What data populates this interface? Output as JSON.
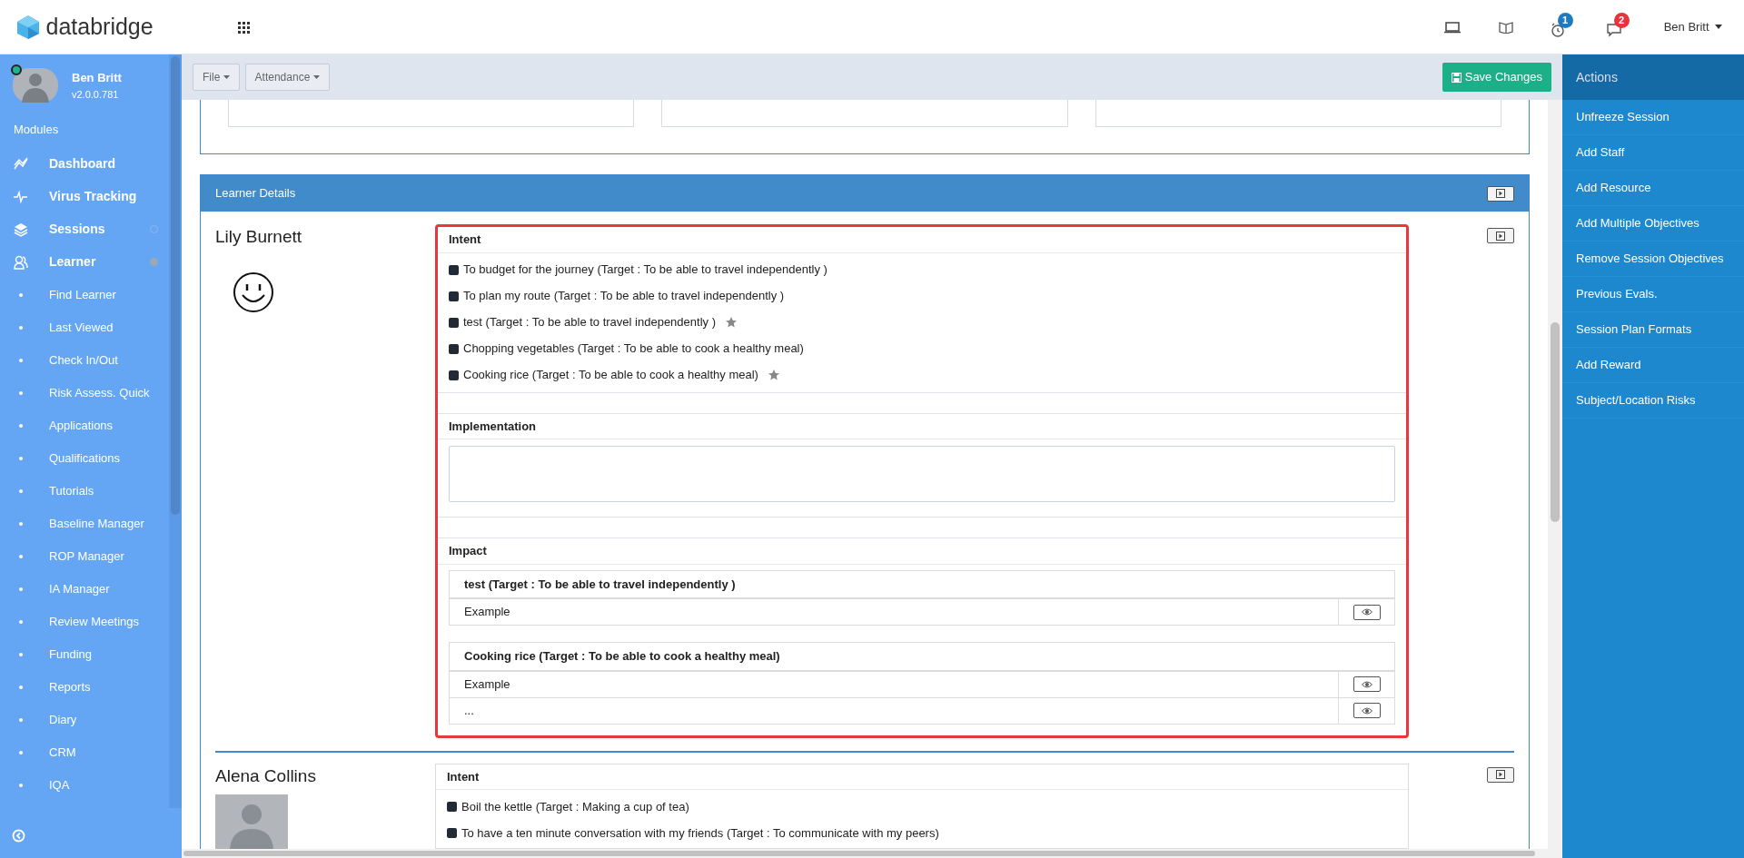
{
  "header": {
    "brand": "databridge",
    "notifications": [
      {
        "kind": "alarm",
        "badge": "1",
        "color": "#1f7bc1"
      },
      {
        "kind": "chat",
        "badge": "2",
        "color": "#e8323c"
      }
    ],
    "user": "Ben Britt"
  },
  "sidebar": {
    "user": {
      "name": "Ben Britt",
      "version": "v2.0.0.781",
      "online": true
    },
    "section": "Modules",
    "items": [
      {
        "label": "Dashboard",
        "kind": "link"
      },
      {
        "label": "Virus Tracking",
        "kind": "link"
      },
      {
        "label": "Sessions",
        "kind": "group",
        "expanded": false
      },
      {
        "label": "Learner",
        "kind": "group",
        "expanded": true,
        "children": [
          {
            "label": "Find Learner"
          },
          {
            "label": "Last Viewed"
          },
          {
            "label": "Check In/Out"
          },
          {
            "label": "Risk Assess. Quick"
          },
          {
            "label": "Applications"
          },
          {
            "label": "Qualifications"
          },
          {
            "label": "Tutorials"
          },
          {
            "label": "Baseline Manager"
          },
          {
            "label": "ROP Manager"
          },
          {
            "label": "IA Manager"
          },
          {
            "label": "Review Meetings"
          },
          {
            "label": "Funding"
          },
          {
            "label": "Reports"
          },
          {
            "label": "Diary"
          },
          {
            "label": "CRM"
          },
          {
            "label": "IQA"
          }
        ]
      }
    ]
  },
  "toolbar": {
    "menus": [
      "File",
      "Attendance"
    ],
    "save": "Save Changes"
  },
  "actions": {
    "title": "Actions",
    "items": [
      "Unfreeze Session",
      "Add Staff",
      "Add Resource",
      "Add Multiple Objectives",
      "Remove Session Objectives",
      "Previous Evals.",
      "Session Plan Formats",
      "Add Reward",
      "Subject/Location Risks"
    ]
  },
  "learner_details": {
    "title": "Learner Details",
    "learners": [
      {
        "name": "Lily Burnett",
        "highlighted": true,
        "intent_heading": "Intent",
        "intent": [
          {
            "text": "To budget for the journey (Target : To be able to travel independently )",
            "starred": false
          },
          {
            "text": "To plan my route (Target : To be able to travel independently )",
            "starred": false
          },
          {
            "text": "test (Target : To be able to travel independently )",
            "starred": true
          },
          {
            "text": "Chopping vegetables (Target : To be able to cook a healthy meal)",
            "starred": false
          },
          {
            "text": "Cooking rice (Target : To be able to cook a healthy meal)",
            "starred": true
          }
        ],
        "implementation_heading": "Implementation",
        "impact_heading": "Impact",
        "impact": [
          {
            "heading": "test (Target : To be able to travel independently )",
            "rows": [
              "Example"
            ]
          },
          {
            "heading": "Cooking rice (Target : To be able to cook a healthy meal)",
            "rows": [
              "Example",
              "..."
            ]
          }
        ]
      },
      {
        "name": "Alena Collins",
        "highlighted": false,
        "intent_heading": "Intent",
        "intent": [
          {
            "text": "Boil the kettle (Target : Making a cup of tea)",
            "starred": false
          },
          {
            "text": "To have a ten minute conversation with my friends (Target : To communicate with my peers)",
            "starred": false
          }
        ]
      }
    ]
  }
}
